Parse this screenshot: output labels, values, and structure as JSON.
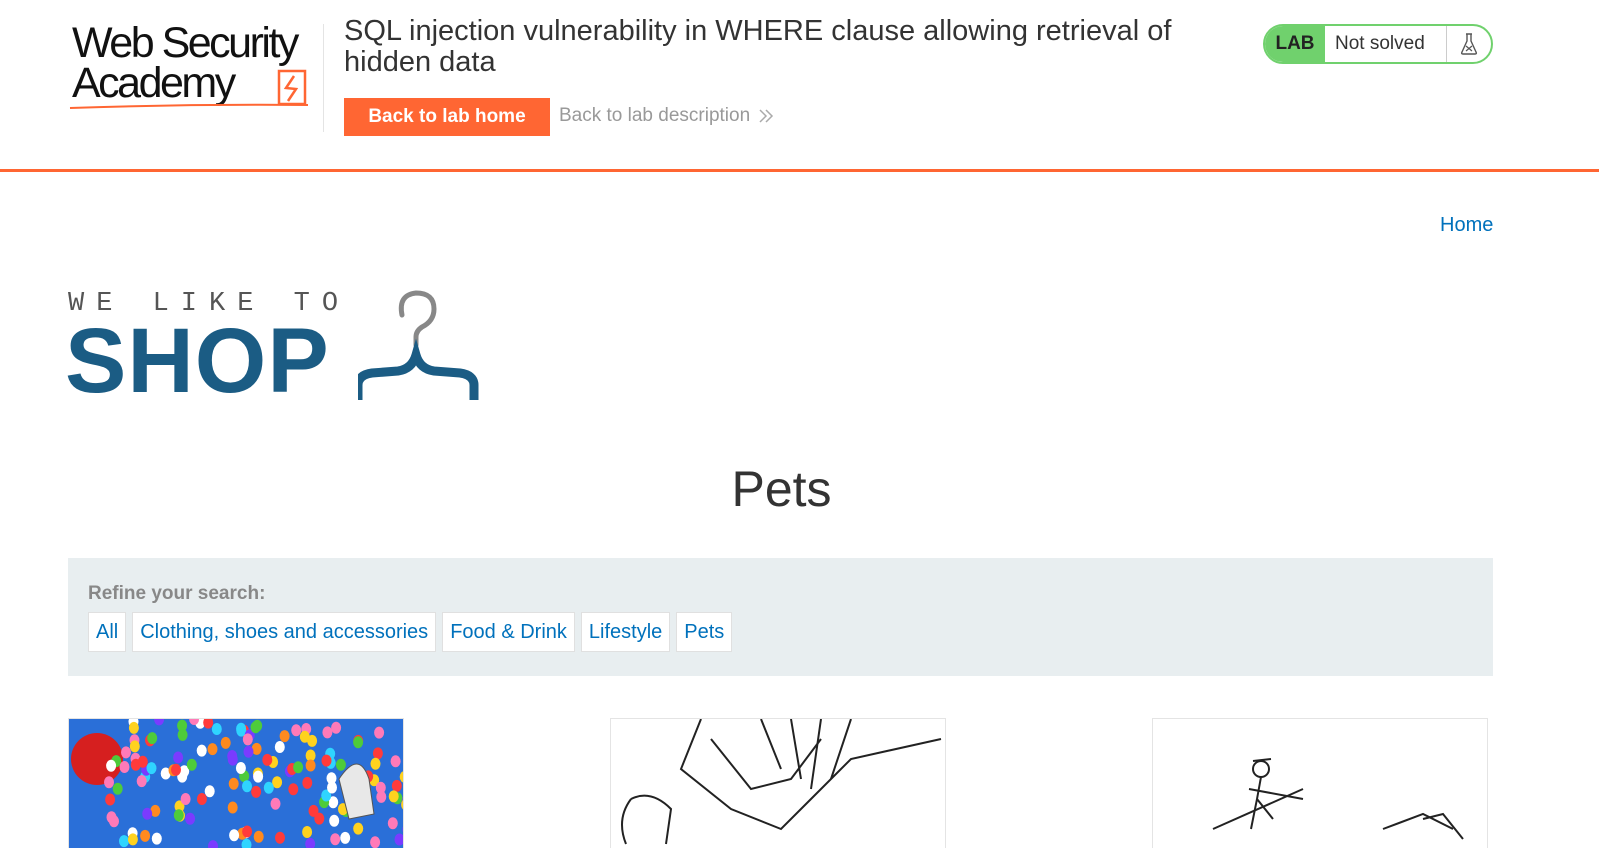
{
  "lab_header": {
    "logo": {
      "line1": "Web Security",
      "line2": "Academy"
    },
    "title": "SQL injection vulnerability in WHERE clause allowing retrieval of hidden data",
    "back_home_label": "Back to lab home",
    "back_description_label": "Back to lab description",
    "status": {
      "tag": "LAB",
      "text": "Not solved"
    }
  },
  "nav": {
    "home_label": "Home"
  },
  "shop_logo": {
    "tagline": "WE LIKE TO",
    "name": "SHOP"
  },
  "page": {
    "heading": "Pets"
  },
  "filters": {
    "label": "Refine your search:",
    "items": [
      "All",
      "Clothing, shoes and accessories",
      "Food & Drink",
      "Lifestyle",
      "Pets"
    ]
  },
  "colors": {
    "accent": "#ff6633",
    "link": "#0071bc",
    "brand": "#1b5c84",
    "lab_status": "#70d16d"
  }
}
